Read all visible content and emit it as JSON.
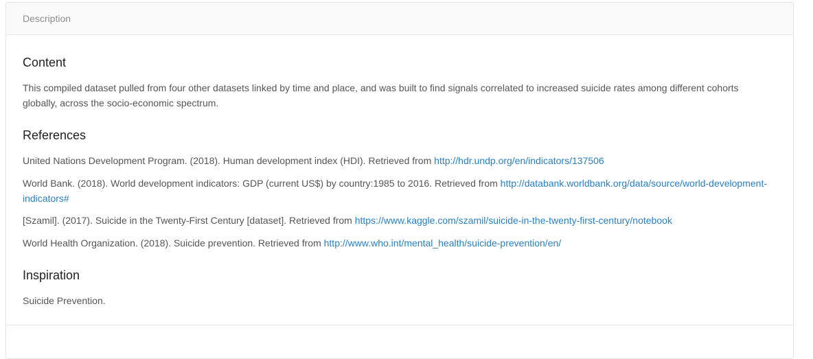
{
  "header": {
    "label": "Description"
  },
  "sections": {
    "content": {
      "title": "Content",
      "text": "This compiled dataset pulled from four other datasets linked by time and place, and was built to find signals correlated to increased suicide rates among different cohorts globally, across the socio-economic spectrum."
    },
    "references": {
      "title": "References",
      "items": [
        {
          "text": "United Nations Development Program. (2018). Human development index (HDI). Retrieved from ",
          "link": "http://hdr.undp.org/en/indicators/137506"
        },
        {
          "text": "World Bank. (2018). World development indicators: GDP (current US$) by country:1985 to 2016. Retrieved from ",
          "link": "http://databank.worldbank.org/data/source/world-development-indicators#"
        },
        {
          "text": "[Szamil]. (2017). Suicide in the Twenty-First Century [dataset]. Retrieved from ",
          "link": "https://www.kaggle.com/szamil/suicide-in-the-twenty-first-century/notebook"
        },
        {
          "text": "World Health Organization. (2018). Suicide prevention. Retrieved from ",
          "link": "http://www.who.int/mental_health/suicide-prevention/en/"
        }
      ]
    },
    "inspiration": {
      "title": "Inspiration",
      "text": "Suicide Prevention."
    }
  }
}
